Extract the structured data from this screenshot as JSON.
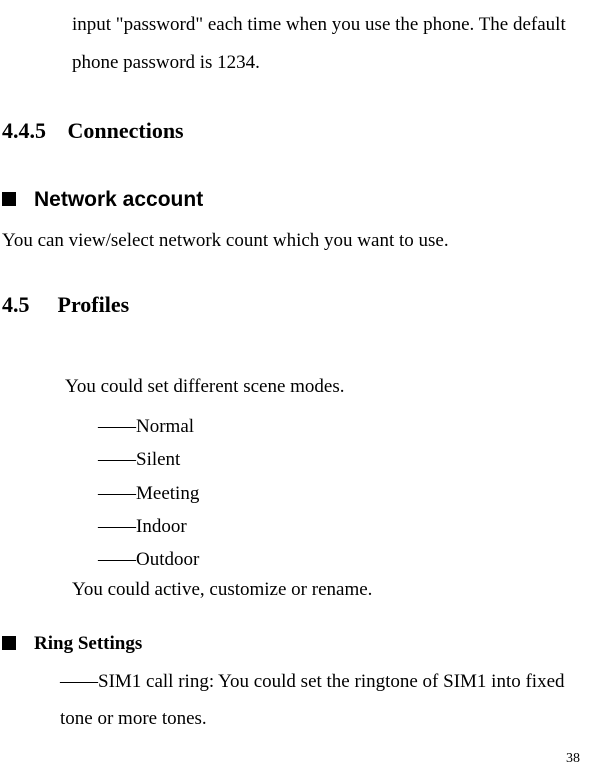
{
  "intro": "input \"password\" each time when you use the phone. The default phone password is 1234.",
  "section445": {
    "num": "4.4.5",
    "title": "Connections"
  },
  "networkAccount": {
    "title": "Network account",
    "desc": "You can view/select network count which you want to use."
  },
  "section45": {
    "num": "4.5",
    "title": "Profiles"
  },
  "scene": {
    "desc": "You could set different scene modes.",
    "items": {
      "0": "——Normal",
      "1": "——Silent",
      "2": "——Meeting",
      "3": "——Indoor",
      "4": "——Outdoor"
    },
    "activeDesc": "You could active, customize or rename."
  },
  "ringSettings": {
    "title": "Ring Settings",
    "desc": "――SIM1 call ring: You could set the ringtone of SIM1 into fixed tone or more tones."
  },
  "pageNumber": "38"
}
